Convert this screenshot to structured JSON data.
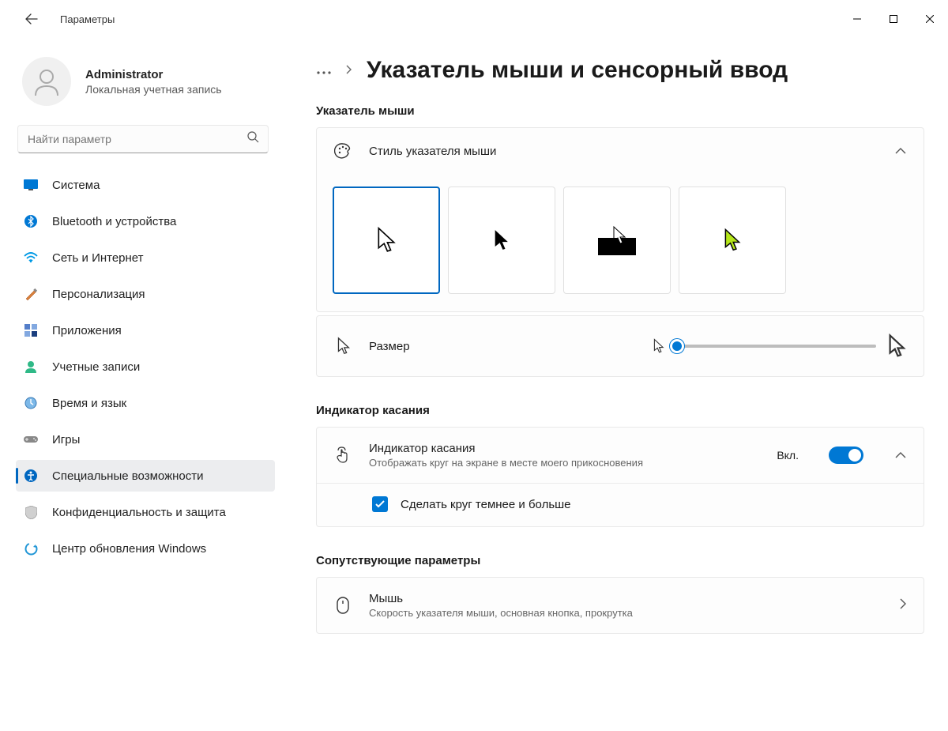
{
  "window": {
    "appTitle": "Параметры"
  },
  "user": {
    "name": "Administrator",
    "subtitle": "Локальная учетная запись"
  },
  "search": {
    "placeholder": "Найти параметр"
  },
  "nav": {
    "items": [
      {
        "label": "Система"
      },
      {
        "label": "Bluetooth и устройства"
      },
      {
        "label": "Сеть и Интернет"
      },
      {
        "label": "Персонализация"
      },
      {
        "label": "Приложения"
      },
      {
        "label": "Учетные записи"
      },
      {
        "label": "Время и язык"
      },
      {
        "label": "Игры"
      },
      {
        "label": "Специальные возможности"
      },
      {
        "label": "Конфиденциальность и защита"
      },
      {
        "label": "Центр обновления Windows"
      }
    ]
  },
  "breadcrumb": {
    "title": "Указатель мыши и сенсорный ввод"
  },
  "sections": {
    "pointer": {
      "heading": "Указатель мыши",
      "styleCard": {
        "title": "Стиль указателя мыши"
      },
      "sizeCard": {
        "label": "Размер"
      }
    },
    "touch": {
      "heading": "Индикатор касания",
      "card": {
        "title": "Индикатор касания",
        "subtitle": "Отображать круг на экране в месте моего прикосновения",
        "toggleLabel": "Вкл."
      },
      "subOption": {
        "label": "Сделать круг темнее и больше"
      }
    },
    "related": {
      "heading": "Сопутствующие параметры",
      "mouse": {
        "title": "Мышь",
        "subtitle": "Скорость указателя мыши, основная кнопка, прокрутка"
      }
    }
  }
}
